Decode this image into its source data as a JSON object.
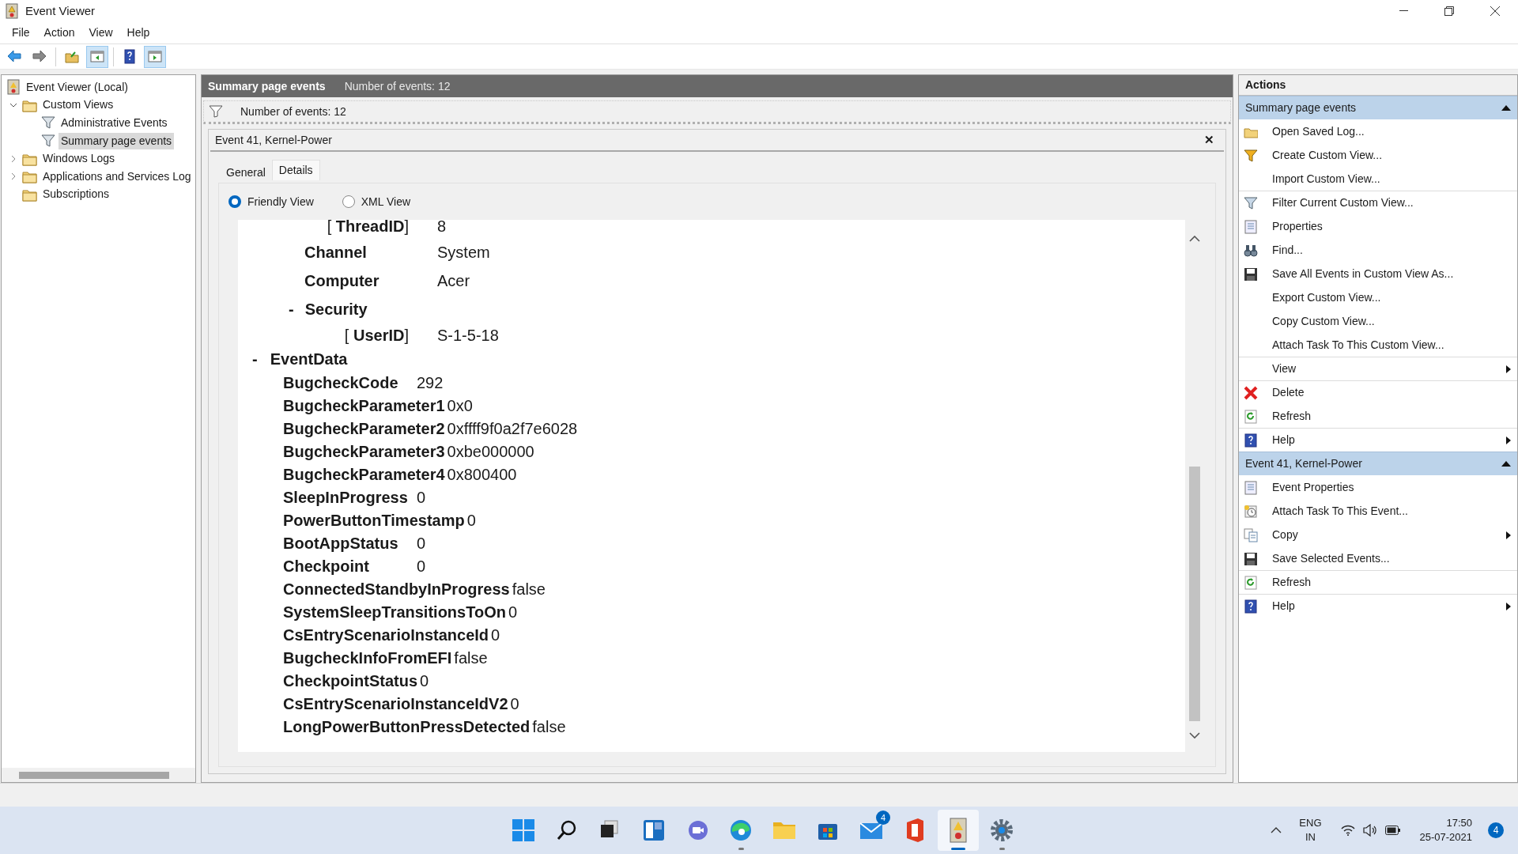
{
  "window": {
    "title": "Event Viewer"
  },
  "menu": [
    "File",
    "Action",
    "View",
    "Help"
  ],
  "toolbar": [
    {
      "pressed": false
    },
    {
      "pressed": false
    },
    {
      "pressed": false
    },
    {
      "pressed": true
    },
    {
      "pressed": false
    },
    {
      "pressed": true
    }
  ],
  "tree": [
    {
      "label": "Event Viewer (Local)",
      "selected": false,
      "children": [
        {
          "label": "Custom Views",
          "selected": false,
          "expanded": true,
          "children": [
            {
              "label": "Administrative Events",
              "selected": false
            },
            {
              "label": "Summary page events",
              "selected": true
            }
          ]
        },
        {
          "label": "Windows Logs",
          "selected": false,
          "expanded": false
        },
        {
          "label": "Applications and Services Log",
          "selected": false,
          "expanded": false
        },
        {
          "label": "Subscriptions",
          "selected": false
        }
      ]
    }
  ],
  "view_header": {
    "title": "Summary page events",
    "count": "Number of events: 12"
  },
  "filter_bar": {
    "text": "Number of events: 12"
  },
  "event": {
    "title": "Event 41, Kernel-Power",
    "close": "✕",
    "tabs": [
      {
        "label": "General",
        "selected": false
      },
      {
        "label": "Details",
        "selected": true
      }
    ],
    "view_options": [
      {
        "label": "Friendly View",
        "selected": true
      },
      {
        "label": "XML View",
        "selected": false
      }
    ],
    "details": [
      {
        "kind": "attr",
        "label": "[ **ThreadID**]",
        "value": "8"
      },
      {
        "kind": "field",
        "label": "Channel",
        "value": "System"
      },
      {
        "kind": "field",
        "label": "Computer",
        "value": "Acer"
      },
      {
        "kind": "section",
        "toggle": "-",
        "label": "Security"
      },
      {
        "kind": "attr",
        "label": "[ **UserID**]",
        "value": "S-1-5-18"
      },
      {
        "kind": "group",
        "toggle": "-",
        "label": "EventData"
      },
      {
        "kind": "data",
        "label": "BugcheckCode",
        "value": "292"
      },
      {
        "kind": "data",
        "label": "BugcheckParameter1",
        "value": "0x0"
      },
      {
        "kind": "data",
        "label": "BugcheckParameter2",
        "value": "0xffff9f0a2f7e6028"
      },
      {
        "kind": "data",
        "label": "BugcheckParameter3",
        "value": "0xbe000000"
      },
      {
        "kind": "data",
        "label": "BugcheckParameter4",
        "value": "0x800400"
      },
      {
        "kind": "data",
        "label": "SleepInProgress",
        "value": "0"
      },
      {
        "kind": "data",
        "label": "PowerButtonTimestamp",
        "value": "0"
      },
      {
        "kind": "data",
        "label": "BootAppStatus",
        "value": "0"
      },
      {
        "kind": "data",
        "label": "Checkpoint",
        "value": "0"
      },
      {
        "kind": "data",
        "label": "ConnectedStandbyInProgress",
        "value": "false"
      },
      {
        "kind": "data",
        "label": "SystemSleepTransitionsToOn",
        "value": "0"
      },
      {
        "kind": "data",
        "label": "CsEntryScenarioInstanceId",
        "value": "0"
      },
      {
        "kind": "data",
        "label": "BugcheckInfoFromEFI",
        "value": "false"
      },
      {
        "kind": "data",
        "label": "CheckpointStatus",
        "value": "0"
      },
      {
        "kind": "data",
        "label": "CsEntryScenarioInstanceIdV2",
        "value": "0"
      },
      {
        "kind": "data",
        "label": "LongPowerButtonPressDetected",
        "value": "false"
      }
    ]
  },
  "actions": {
    "title": "Actions",
    "sections": [
      {
        "title": "Summary page events",
        "expanded": true,
        "items": [
          {
            "label": "Open Saved Log...",
            "submenu": false,
            "separator_before": false
          },
          {
            "label": "Create Custom View...",
            "submenu": false,
            "separator_before": false
          },
          {
            "label": "Import Custom View...",
            "submenu": false,
            "separator_before": false
          },
          {
            "label": "Filter Current Custom View...",
            "submenu": false,
            "separator_before": true
          },
          {
            "label": "Properties",
            "submenu": false,
            "separator_before": false
          },
          {
            "label": "Find...",
            "submenu": false,
            "separator_before": false
          },
          {
            "label": "Save All Events in Custom View As...",
            "submenu": false,
            "separator_before": false
          },
          {
            "label": "Export Custom View...",
            "submenu": false,
            "separator_before": false
          },
          {
            "label": "Copy Custom View...",
            "submenu": false,
            "separator_before": false
          },
          {
            "label": "Attach Task To This Custom View...",
            "submenu": false,
            "separator_before": false
          },
          {
            "label": "View",
            "submenu": true,
            "separator_before": true
          },
          {
            "label": "Delete",
            "submenu": false,
            "separator_before": true
          },
          {
            "label": "Refresh",
            "submenu": false,
            "separator_before": false
          },
          {
            "label": "Help",
            "submenu": true,
            "separator_before": true
          }
        ]
      },
      {
        "title": "Event 41, Kernel-Power",
        "expanded": true,
        "items": [
          {
            "label": "Event Properties",
            "submenu": false,
            "separator_before": false
          },
          {
            "label": "Attach Task To This Event...",
            "submenu": false,
            "separator_before": false
          },
          {
            "label": "Copy",
            "submenu": true,
            "separator_before": false
          },
          {
            "label": "Save Selected Events...",
            "submenu": false,
            "separator_before": false
          },
          {
            "label": "Refresh",
            "submenu": false,
            "separator_before": true
          },
          {
            "label": "Help",
            "submenu": true,
            "separator_before": true
          }
        ]
      }
    ]
  },
  "taskbar": {
    "apps": [
      {
        "running": false,
        "active": false
      },
      {
        "running": false,
        "active": false
      },
      {
        "running": false,
        "active": false
      },
      {
        "running": false,
        "active": false
      },
      {
        "running": false,
        "active": false
      },
      {
        "running": true,
        "active": false
      },
      {
        "running": false,
        "active": false
      },
      {
        "running": false,
        "active": false
      },
      {
        "running": false,
        "active": false,
        "badge": "4"
      },
      {
        "running": false,
        "active": false
      },
      {
        "running": true,
        "active": true
      },
      {
        "running": true,
        "active": false
      }
    ],
    "language": "ENG",
    "region": "IN",
    "time": "17:50",
    "date": "25-07-2021",
    "notifications": "4"
  }
}
